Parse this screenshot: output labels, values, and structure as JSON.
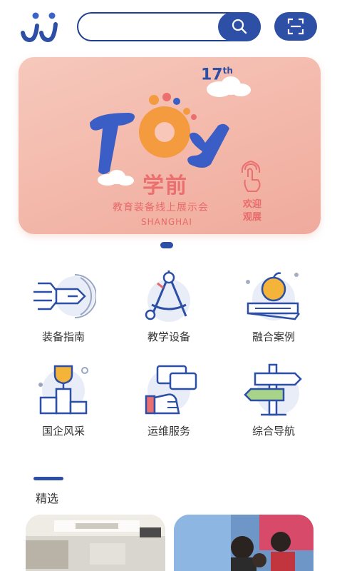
{
  "header": {
    "logo_icon": "ji-logo-icon",
    "search": {
      "placeholder": "",
      "value": "",
      "icon": "search-icon"
    },
    "scan_icon": "scan-icon"
  },
  "banner": {
    "edition": "17",
    "edition_suffix": "th",
    "title_art": "TOY",
    "subtitle": "学前",
    "line": "教育装备线上展示会",
    "city": "SHANGHAI",
    "welcome_1": "欢迎",
    "welcome_2": "观展",
    "active_slide": 1,
    "colors": {
      "bg": "#f3b8aa",
      "text": "#eb6f6f",
      "brand": "#2d4fa5"
    }
  },
  "grid": [
    {
      "label": "装备指南",
      "icon": "guide-arrow-icon"
    },
    {
      "label": "教学设备",
      "icon": "compass-icon"
    },
    {
      "label": "融合案例",
      "icon": "apple-book-icon"
    },
    {
      "label": "国企风采",
      "icon": "trophy-podium-icon"
    },
    {
      "label": "运维服务",
      "icon": "service-hand-icon"
    },
    {
      "label": "综合导航",
      "icon": "signpost-icon"
    }
  ],
  "featured": {
    "title": "精选",
    "cards": [
      {
        "name": "classroom-photo"
      },
      {
        "name": "students-photo"
      }
    ]
  }
}
